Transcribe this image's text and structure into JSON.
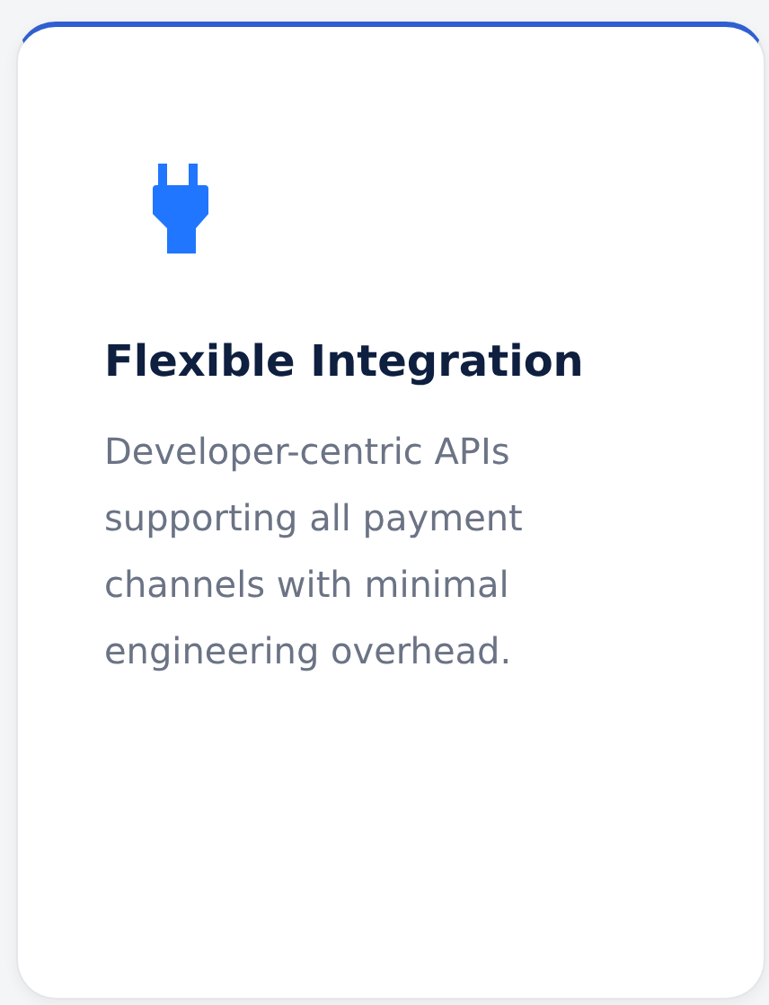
{
  "card": {
    "title": "Flexible Integration",
    "description": "Developer-centric APIs supporting all payment channels with minimal engineering overhead."
  }
}
